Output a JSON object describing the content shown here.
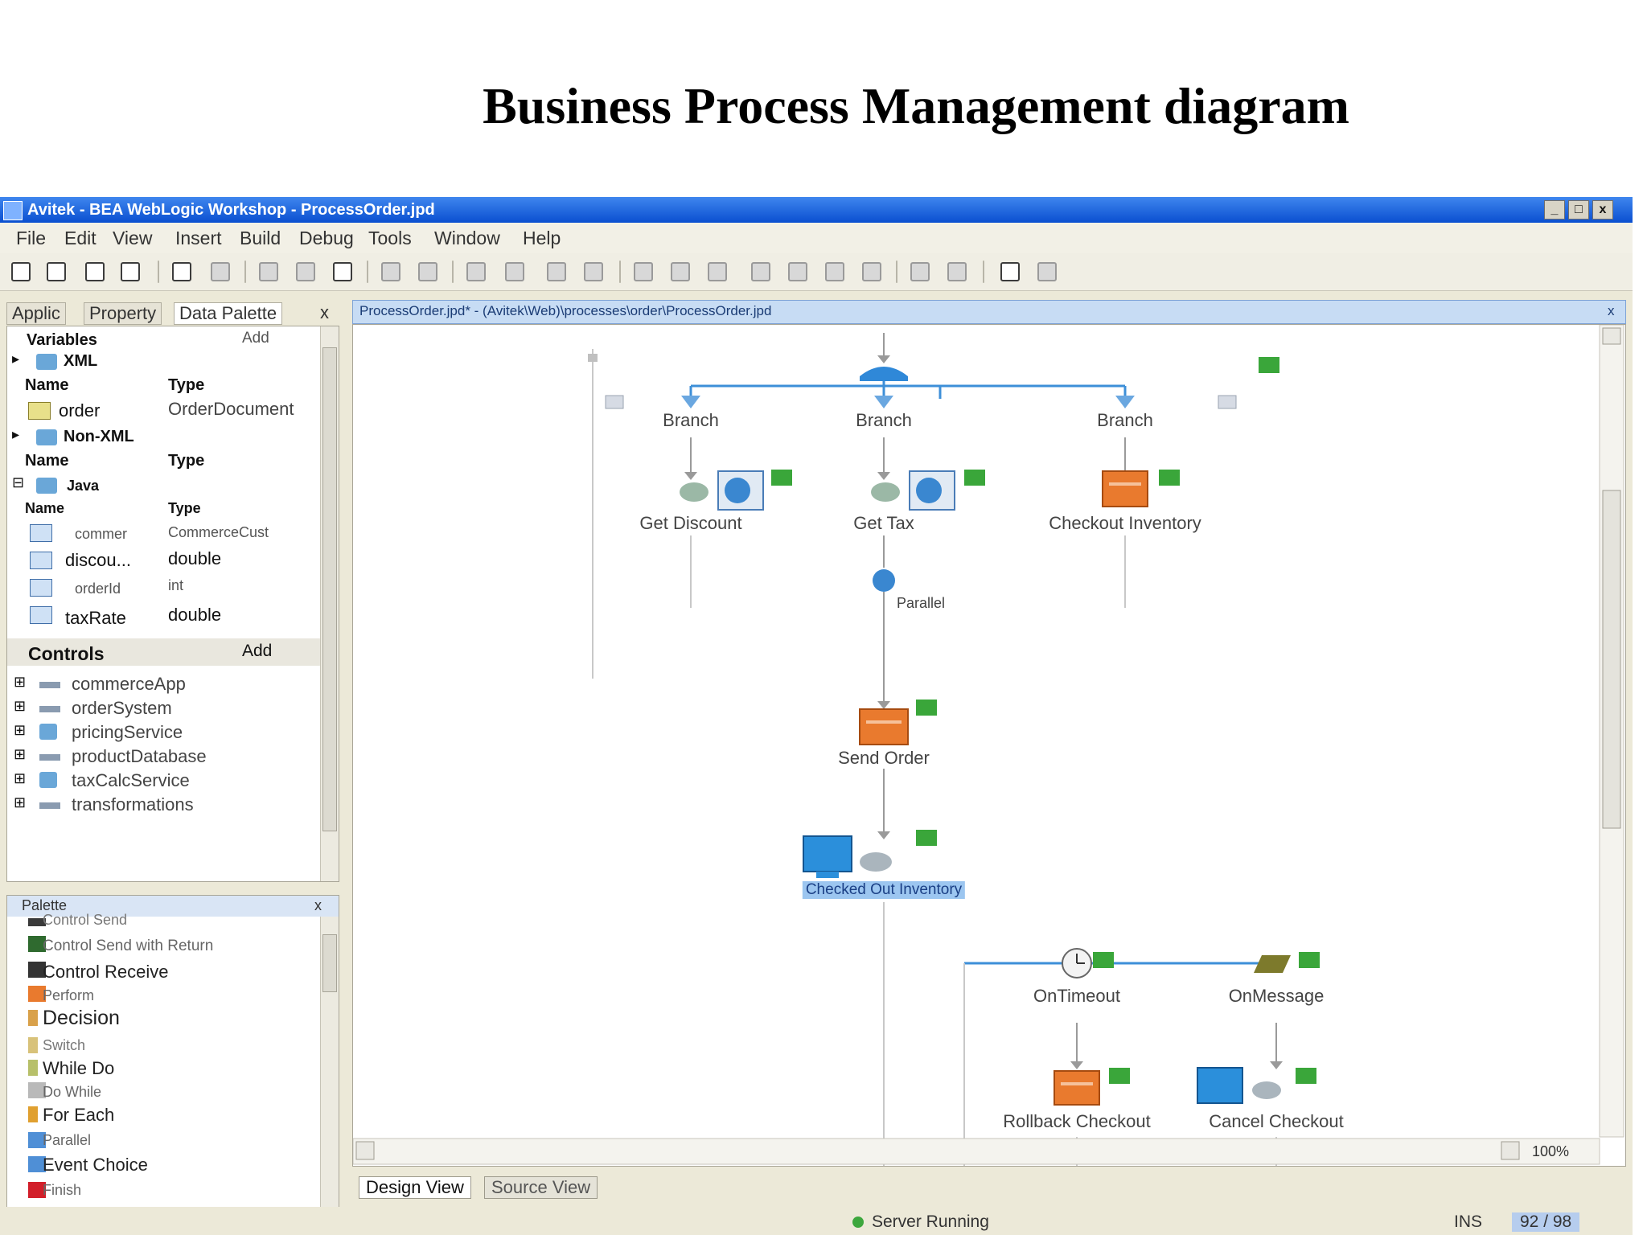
{
  "slide": {
    "title": "Business Process Management diagram"
  },
  "window": {
    "title": "Avitek - BEA WebLogic Workshop - ProcessOrder.jpd",
    "controls": [
      "_",
      "□",
      "x"
    ]
  },
  "menu": {
    "items": [
      "File",
      "Edit",
      "View",
      "Insert",
      "Build",
      "Debug",
      "Tools",
      "Window",
      "Help"
    ]
  },
  "left_tabs": [
    "Applic",
    "Property",
    "Data Palette",
    "x"
  ],
  "variables": {
    "header": "Variables",
    "add_label": "Add",
    "xml_group": "XML",
    "non_xml_group": "Non-XML",
    "java_group": "Java",
    "name_col": "Name",
    "type_col": "Type",
    "xml_rows": [
      {
        "name": "order",
        "type": "OrderDocument"
      }
    ],
    "java_rows": [
      {
        "name": "commer",
        "type": "CommerceCust"
      },
      {
        "name": "discou...",
        "type": "double"
      },
      {
        "name": "orderId",
        "type": "int"
      },
      {
        "name": "taxRate",
        "type": "double"
      }
    ]
  },
  "controls": {
    "header": "Controls",
    "add_label": "Add",
    "items": [
      "commerceApp",
      "orderSystem",
      "pricingService",
      "productDatabase",
      "taxCalcService",
      "transformations"
    ]
  },
  "palette": {
    "header": "Palette",
    "close": "x",
    "items": [
      "Control Send",
      "Control Send with Return",
      "Control Receive",
      "Perform",
      "Decision",
      "Switch",
      "While Do",
      "Do While",
      "For Each",
      "Parallel",
      "Event Choice",
      "Finish"
    ]
  },
  "editor": {
    "tab_title": "ProcessOrder.jpd* - (Avitek\\Web)\\processes\\order\\ProcessOrder.jpd",
    "close": "x",
    "nodes": {
      "branch_left": "Branch",
      "branch_mid": "Branch",
      "branch_right": "Branch",
      "get_discount": "Get Discount",
      "get_tax": "Get Tax",
      "checkout_inventory": "Checkout Inventory",
      "parallel": "Parallel",
      "send_order": "Send Order",
      "checked_out_inventory": "Checked Out Inventory",
      "on_timeout": "OnTimeout",
      "on_message": "OnMessage",
      "rollback_checkout": "Rollback Checkout",
      "cancel_checkout": "Cancel Checkout"
    },
    "zoom": "100%"
  },
  "bottom_tabs": [
    "Design View",
    "Source View"
  ],
  "status": {
    "server": "Server Running",
    "mode": "INS",
    "position": "92 / 98"
  },
  "colors": {
    "titlebar": "#0a4fd0",
    "flow_line": "#3d8fd8",
    "check": "#3aa63a",
    "service_orange": "#e97a2e"
  }
}
